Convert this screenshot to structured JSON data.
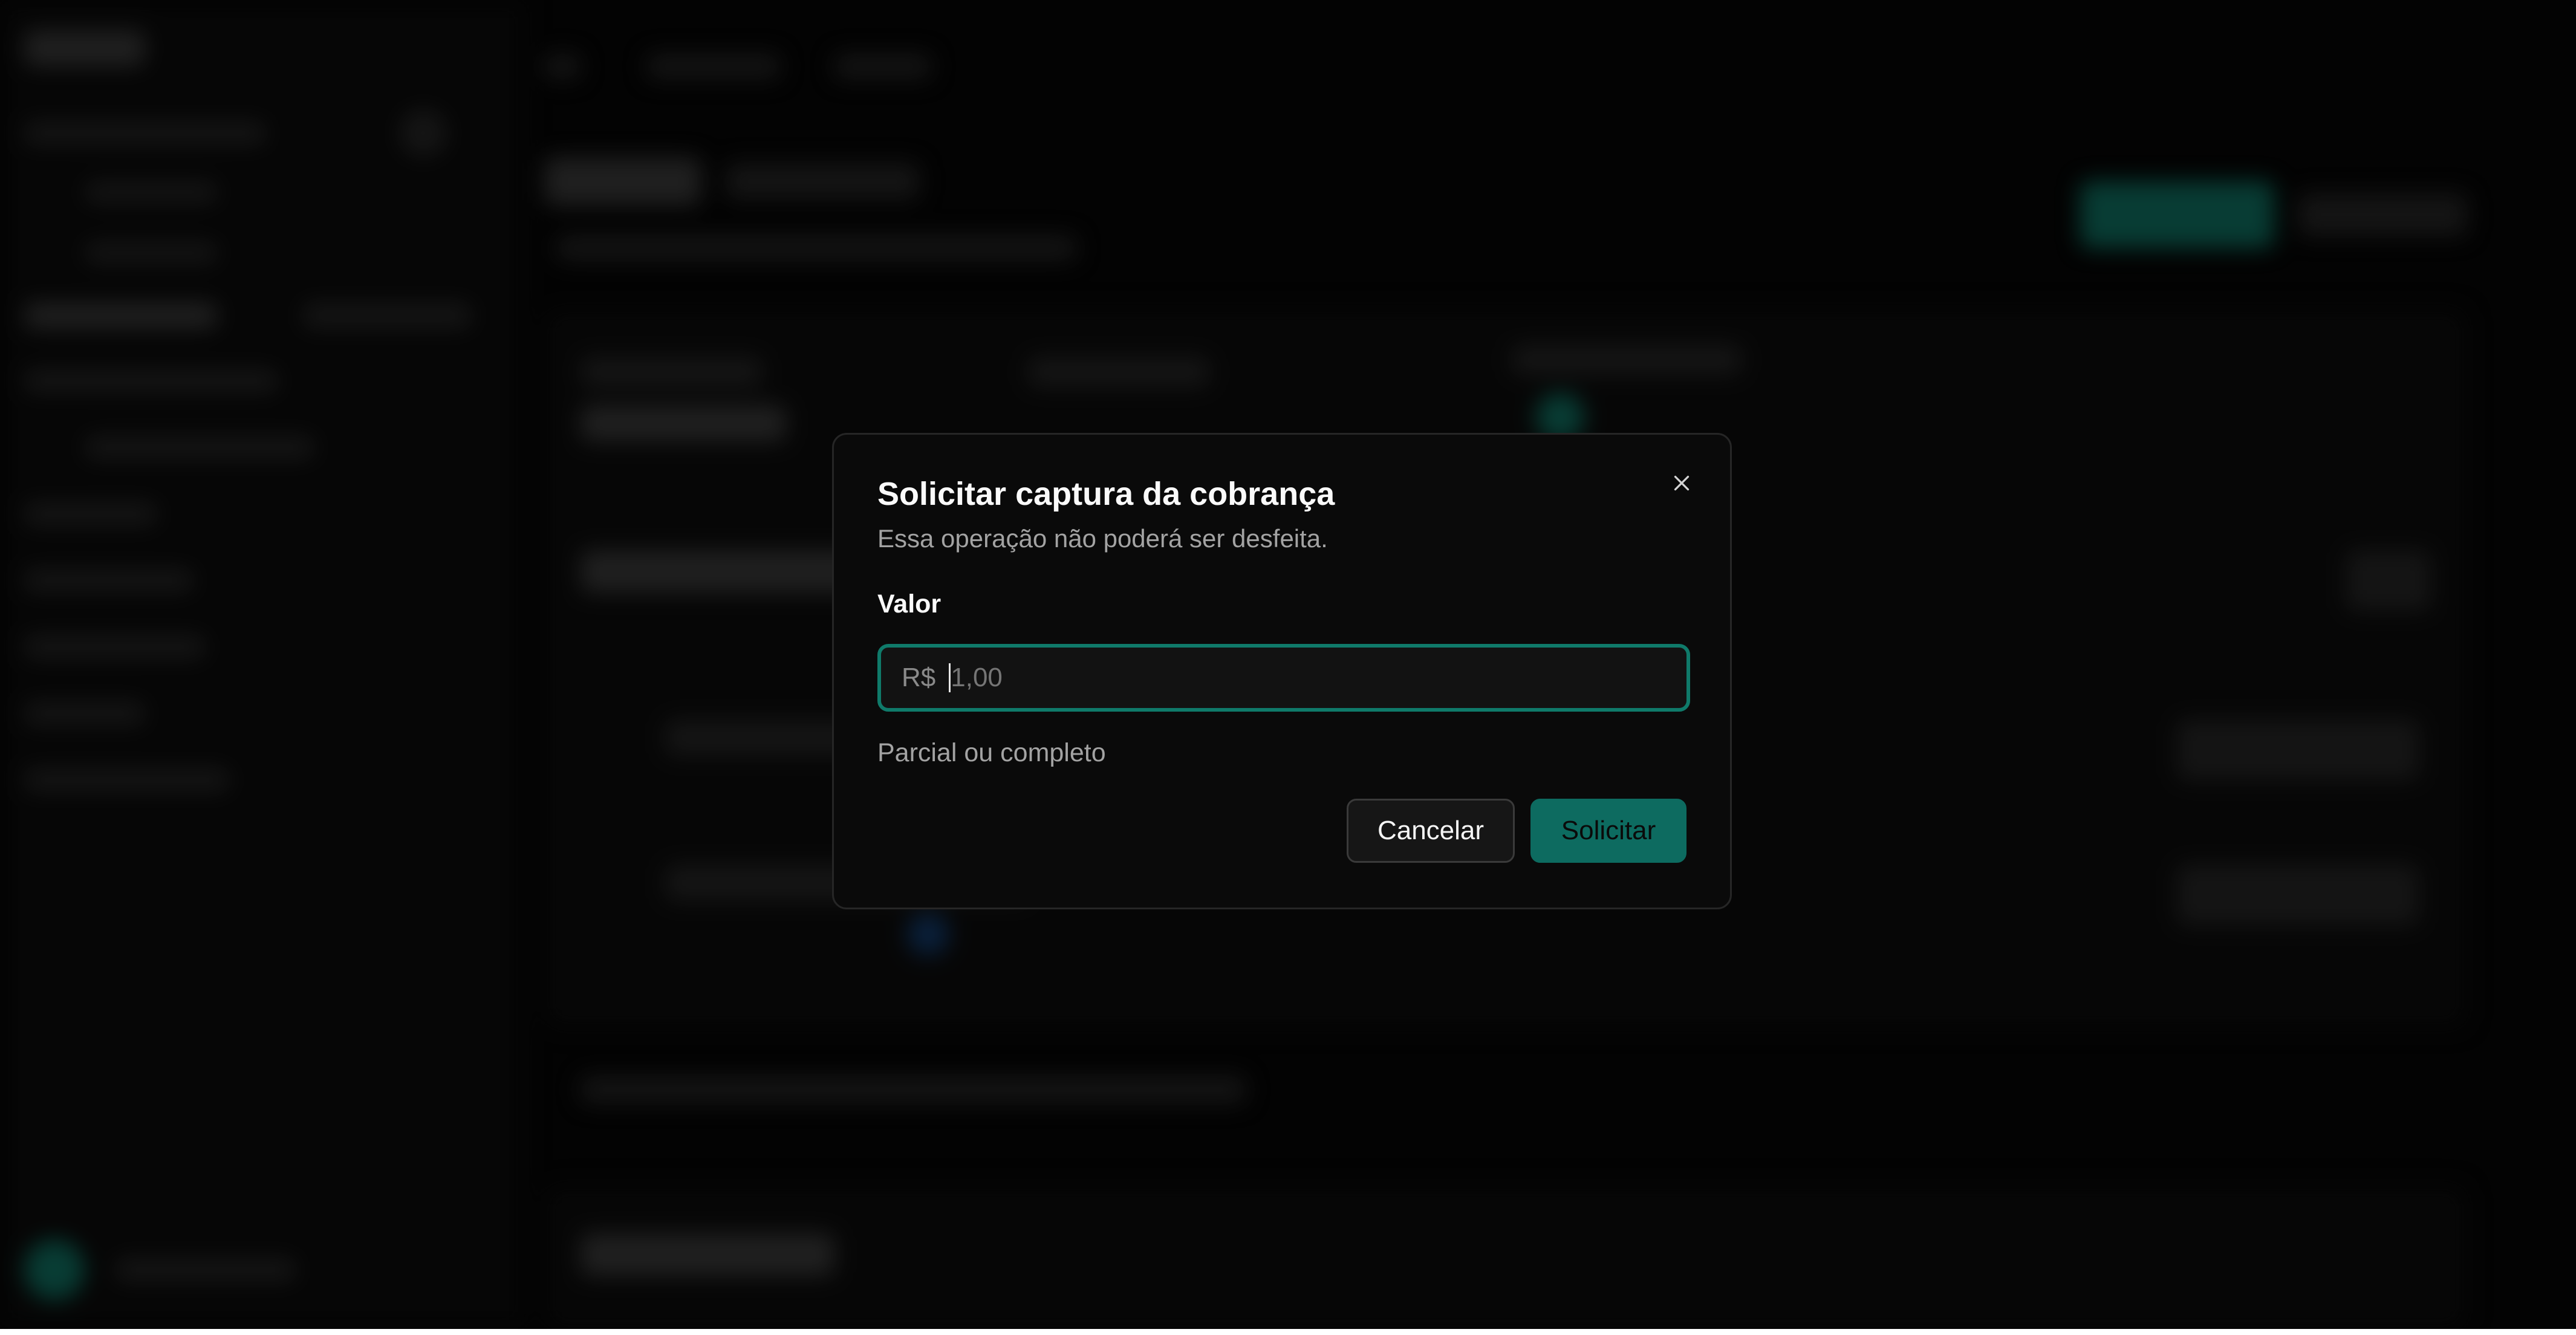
{
  "dialog": {
    "title": "Solicitar captura da cobrança",
    "description": "Essa operação não poderá ser desfeita.",
    "field_label": "Valor",
    "currency_prefix": "R$",
    "amount_placeholder": "1,00",
    "hint": "Parcial ou completo",
    "cancel_label": "Cancelar",
    "submit_label": "Solicitar",
    "close_icon": "close-icon"
  },
  "colors": {
    "accent": "#0f7a6a",
    "submit_bg": "#0d6b60",
    "dialog_bg": "#0a0a0a",
    "backdrop": "#060606"
  }
}
